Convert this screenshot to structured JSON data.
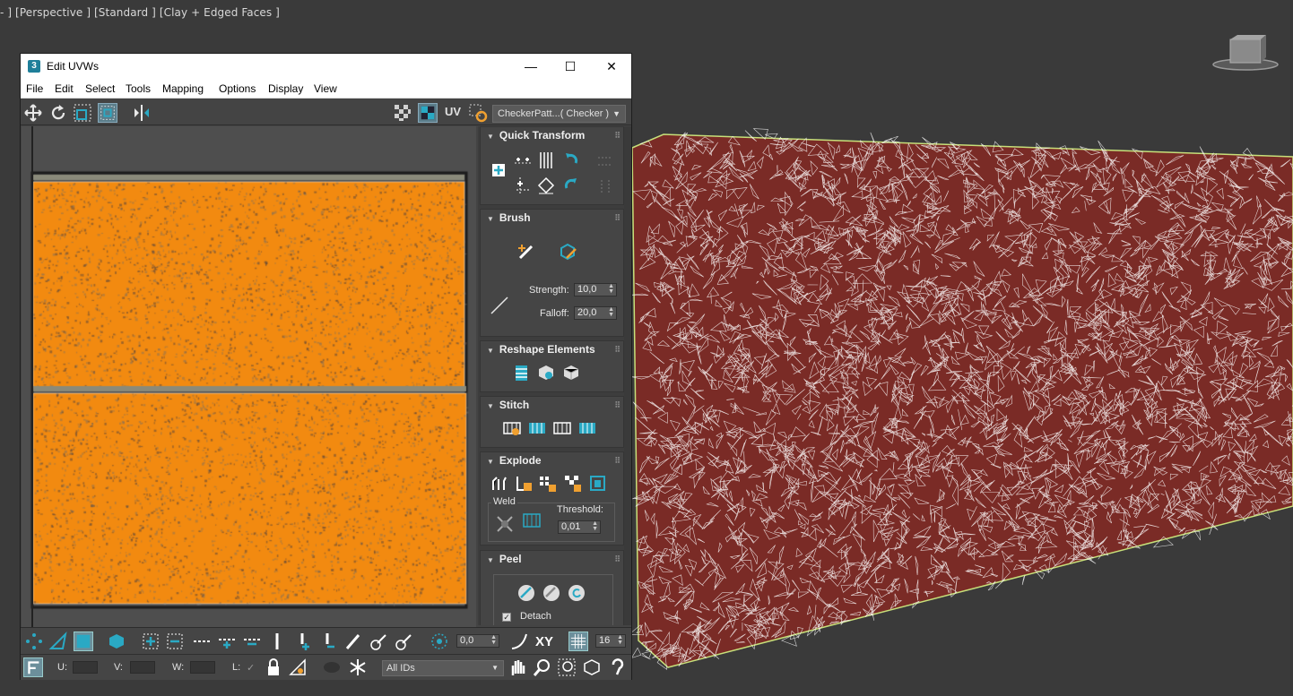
{
  "viewport": {
    "label": "- ] [Perspective ] [Standard ] [Clay + Edged Faces ]",
    "bg_color": "#3a3a3a",
    "mesh_wire_color": "#ffffff",
    "mesh_face_color": "#7a2b26"
  },
  "window": {
    "icon_text": "3",
    "title": "Edit UVWs",
    "minimize": "—",
    "maximize": "☐",
    "close": "✕"
  },
  "menu": [
    "File",
    "Edit",
    "Select",
    "Tools",
    "Mapping",
    "Options",
    "Display",
    "View"
  ],
  "top_toolbar": {
    "icons": [
      "move-icon",
      "rotate-icon",
      "scale-icon",
      "freeform-icon",
      "mirror-icon",
      "checker-grid-icon",
      "checker-pattern-icon",
      "uv-icon",
      "settings-icon"
    ],
    "uv_label": "UV",
    "map_dropdown": "CheckerPatt...( Checker )"
  },
  "uv_editor": {
    "uv_fill_color": "#f28a10"
  },
  "panel": {
    "quick_transform": {
      "title": "Quick Transform"
    },
    "brush": {
      "title": "Brush",
      "strength_label": "Strength:",
      "strength_value": "10,0",
      "falloff_label": "Falloff:",
      "falloff_value": "20,0"
    },
    "reshape": {
      "title": "Reshape Elements"
    },
    "stitch": {
      "title": "Stitch"
    },
    "explode": {
      "title": "Explode",
      "weld_label": "Weld",
      "threshold_label": "Threshold:",
      "threshold_value": "0,01"
    },
    "peel": {
      "title": "Peel",
      "detach_label": "Detach",
      "detach_checked": true
    }
  },
  "bottom_toolbar": {
    "soft_value": "0,0",
    "xy_label": "XY",
    "grid_value": "16",
    "u_label": "U:",
    "v_label": "V:",
    "w_label": "W:",
    "l_label": "L:",
    "ids_dropdown": "All IDs"
  },
  "accent_color": "#2aa9c4"
}
